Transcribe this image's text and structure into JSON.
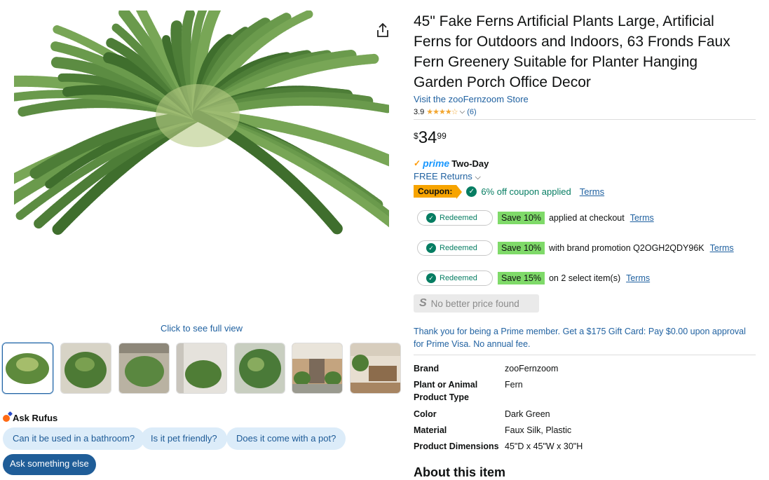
{
  "image": {
    "see_full": "Click to see full view",
    "thumbnail_count": 7
  },
  "rufus": {
    "title": "Ask Rufus",
    "suggestions": [
      "Can it be used in a bathroom?",
      "Is it pet friendly?",
      "Does it come with a pot?"
    ],
    "ask_else": "Ask something else"
  },
  "product": {
    "title": "45\" Fake Ferns Artificial Plants Large, Artificial Ferns for Outdoors and Indoors, 63 Fronds Faux Fern Greenery Suitable for Planter Hanging Garden Porch Office Decor",
    "store": "Visit the zooFernzoom Store",
    "rating": "3.9",
    "rating_count": "(6)",
    "price_symbol": "$",
    "price_whole": "34",
    "price_fraction": "99"
  },
  "delivery": {
    "prime_label": "prime",
    "two_day": "Two-Day",
    "returns": "FREE Returns"
  },
  "coupon": {
    "tag": "Coupon:",
    "text": "6% off coupon applied",
    "terms": "Terms"
  },
  "promotions": [
    {
      "badge": "Redeemed",
      "save": "Save 10%",
      "text": "applied at checkout",
      "terms": "Terms"
    },
    {
      "badge": "Redeemed",
      "save": "Save 10%",
      "text": "with brand promotion Q2OGH2QDY96K",
      "terms": "Terms"
    },
    {
      "badge": "Redeemed",
      "save": "Save 15%",
      "text": "on 2 select item(s)",
      "terms": "Terms"
    }
  ],
  "no_better_price": "No better price found",
  "prime_offer": "Thank you for being a Prime member. Get a $175 Gift Card: Pay $0.00 upon approval for Prime Visa. No annual fee.",
  "specs": [
    {
      "label": "Brand",
      "value": "zooFernzoom"
    },
    {
      "label": "Plant or Animal Product Type",
      "value": "Fern"
    },
    {
      "label": "Color",
      "value": "Dark Green"
    },
    {
      "label": "Material",
      "value": "Faux Silk, Plastic"
    },
    {
      "label": "Product Dimensions",
      "value": "45\"D x 45\"W x 30\"H"
    }
  ],
  "about_heading": "About this item",
  "colors": {
    "link": "#2162a1",
    "green": "#067d62",
    "coupon": "#f7a400",
    "save": "#7fda69",
    "prime": "#1a98ff"
  }
}
